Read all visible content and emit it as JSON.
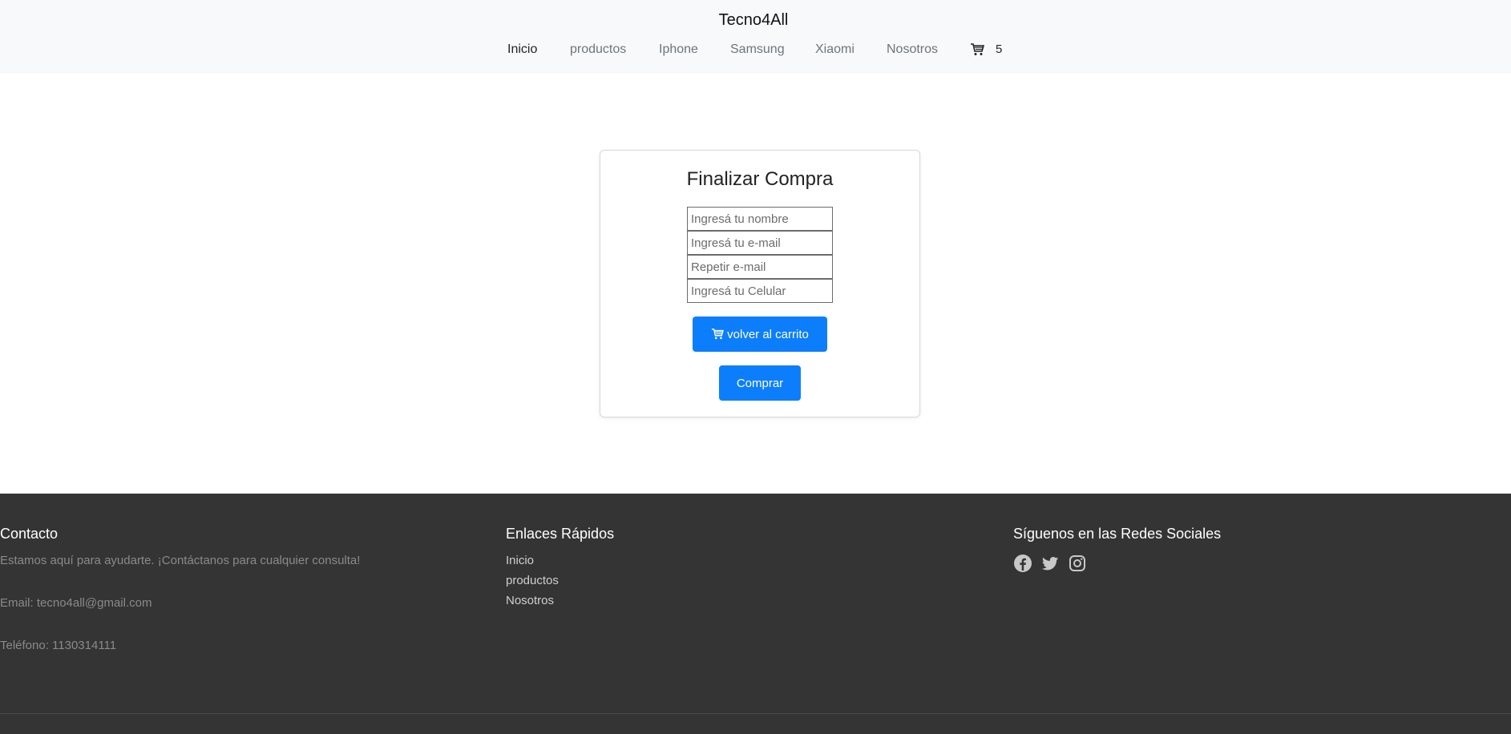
{
  "header": {
    "brand": "Tecno4All",
    "nav": [
      "Inicio",
      "productos",
      "Iphone",
      "Samsung",
      "Xiaomi",
      "Nosotros"
    ],
    "cart_count": "5"
  },
  "checkout": {
    "title": "Finalizar Compra",
    "fields": {
      "name_placeholder": "Ingresá tu nombre",
      "email_placeholder": "Ingresá tu e-mail",
      "email_repeat_placeholder": "Repetir e-mail",
      "phone_placeholder": "Ingresá tu Celular"
    },
    "back_button": "volver al carrito",
    "buy_button": "Comprar",
    "accent_color": "#0d7efb"
  },
  "footer": {
    "contact": {
      "title": "Contacto",
      "lines": [
        "Estamos aquí para ayudarte. ¡Contáctanos para cualquier consulta!",
        "Email: tecno4all@gmail.com",
        "Teléfono: 1130314111"
      ]
    },
    "links": {
      "title": "Enlaces Rápidos",
      "items": [
        "Inicio",
        "productos",
        "Nosotros"
      ]
    },
    "social": {
      "title": "Síguenos en las Redes Sociales",
      "icons": [
        "facebook-icon",
        "twitter-icon",
        "instagram-icon"
      ]
    },
    "background_color": "#343434"
  }
}
